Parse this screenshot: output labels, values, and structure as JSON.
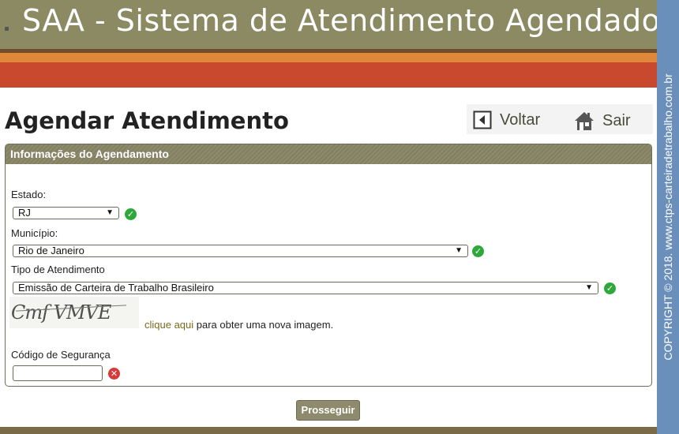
{
  "header": {
    "title": "SAA - Sistema de Atendimento Agendado"
  },
  "watermark": {
    "text": "COPYRIGHT © 2018.  www.ctps-carteiradetrabalho.com.br"
  },
  "page": {
    "title": "Agendar Atendimento"
  },
  "nav": {
    "voltar_label": "Voltar",
    "sair_label": "Sair"
  },
  "panel": {
    "title": "Informações do Agendamento"
  },
  "form": {
    "estado": {
      "label": "Estado:",
      "value": "RJ",
      "status": "valid"
    },
    "municipio": {
      "label": "Município:",
      "value": "Rio de Janeiro",
      "status": "valid"
    },
    "tipo": {
      "label": "Tipo de Atendimento",
      "value": "Emissão de Carteira de Trabalho Brasileiro",
      "status": "valid"
    },
    "captcha": {
      "image_text": "Cmf VMVE",
      "link_label": "clique aqui",
      "suffix": " para obter uma nova imagem."
    },
    "codigo": {
      "label": "Código de Segurança",
      "value": "",
      "status": "invalid"
    }
  },
  "actions": {
    "submit_label": "Prosseguir"
  },
  "icons": {
    "voltar": "back-arrow-icon",
    "sair": "home-icon",
    "valid": "check-circle-icon",
    "invalid": "x-circle-icon"
  },
  "colors": {
    "header": "#8b8a63",
    "stripe": "#c8492e",
    "accent": "#8e8a6d",
    "sidebar": "#6b8fbb",
    "valid": "#2ea83a",
    "invalid": "#d83a3a"
  }
}
